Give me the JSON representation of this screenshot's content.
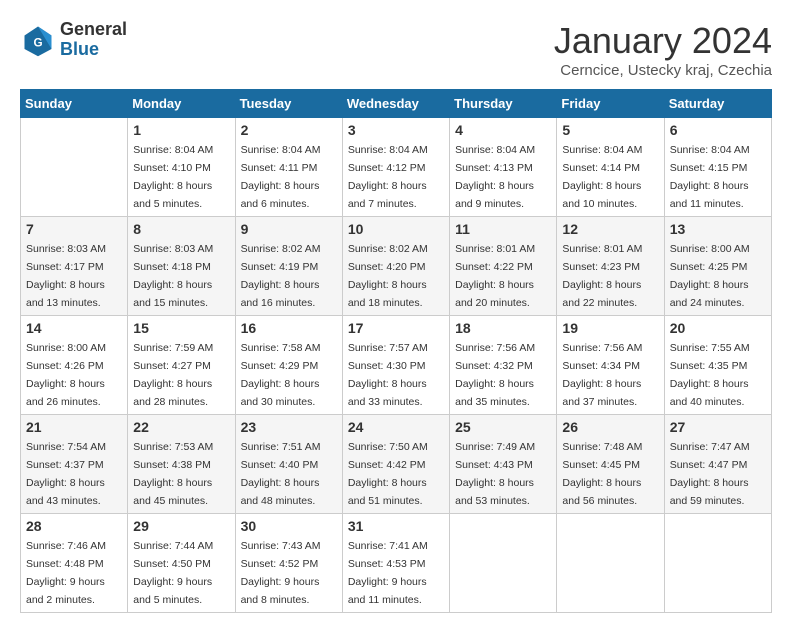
{
  "header": {
    "logo_general": "General",
    "logo_blue": "Blue",
    "month_title": "January 2024",
    "subtitle": "Cerncice, Ustecky kraj, Czechia"
  },
  "weekdays": [
    "Sunday",
    "Monday",
    "Tuesday",
    "Wednesday",
    "Thursday",
    "Friday",
    "Saturday"
  ],
  "weeks": [
    [
      {
        "day": "",
        "sunrise": "",
        "sunset": "",
        "daylight": ""
      },
      {
        "day": "1",
        "sunrise": "Sunrise: 8:04 AM",
        "sunset": "Sunset: 4:10 PM",
        "daylight": "Daylight: 8 hours and 5 minutes."
      },
      {
        "day": "2",
        "sunrise": "Sunrise: 8:04 AM",
        "sunset": "Sunset: 4:11 PM",
        "daylight": "Daylight: 8 hours and 6 minutes."
      },
      {
        "day": "3",
        "sunrise": "Sunrise: 8:04 AM",
        "sunset": "Sunset: 4:12 PM",
        "daylight": "Daylight: 8 hours and 7 minutes."
      },
      {
        "day": "4",
        "sunrise": "Sunrise: 8:04 AM",
        "sunset": "Sunset: 4:13 PM",
        "daylight": "Daylight: 8 hours and 9 minutes."
      },
      {
        "day": "5",
        "sunrise": "Sunrise: 8:04 AM",
        "sunset": "Sunset: 4:14 PM",
        "daylight": "Daylight: 8 hours and 10 minutes."
      },
      {
        "day": "6",
        "sunrise": "Sunrise: 8:04 AM",
        "sunset": "Sunset: 4:15 PM",
        "daylight": "Daylight: 8 hours and 11 minutes."
      }
    ],
    [
      {
        "day": "7",
        "sunrise": "Sunrise: 8:03 AM",
        "sunset": "Sunset: 4:17 PM",
        "daylight": "Daylight: 8 hours and 13 minutes."
      },
      {
        "day": "8",
        "sunrise": "Sunrise: 8:03 AM",
        "sunset": "Sunset: 4:18 PM",
        "daylight": "Daylight: 8 hours and 15 minutes."
      },
      {
        "day": "9",
        "sunrise": "Sunrise: 8:02 AM",
        "sunset": "Sunset: 4:19 PM",
        "daylight": "Daylight: 8 hours and 16 minutes."
      },
      {
        "day": "10",
        "sunrise": "Sunrise: 8:02 AM",
        "sunset": "Sunset: 4:20 PM",
        "daylight": "Daylight: 8 hours and 18 minutes."
      },
      {
        "day": "11",
        "sunrise": "Sunrise: 8:01 AM",
        "sunset": "Sunset: 4:22 PM",
        "daylight": "Daylight: 8 hours and 20 minutes."
      },
      {
        "day": "12",
        "sunrise": "Sunrise: 8:01 AM",
        "sunset": "Sunset: 4:23 PM",
        "daylight": "Daylight: 8 hours and 22 minutes."
      },
      {
        "day": "13",
        "sunrise": "Sunrise: 8:00 AM",
        "sunset": "Sunset: 4:25 PM",
        "daylight": "Daylight: 8 hours and 24 minutes."
      }
    ],
    [
      {
        "day": "14",
        "sunrise": "Sunrise: 8:00 AM",
        "sunset": "Sunset: 4:26 PM",
        "daylight": "Daylight: 8 hours and 26 minutes."
      },
      {
        "day": "15",
        "sunrise": "Sunrise: 7:59 AM",
        "sunset": "Sunset: 4:27 PM",
        "daylight": "Daylight: 8 hours and 28 minutes."
      },
      {
        "day": "16",
        "sunrise": "Sunrise: 7:58 AM",
        "sunset": "Sunset: 4:29 PM",
        "daylight": "Daylight: 8 hours and 30 minutes."
      },
      {
        "day": "17",
        "sunrise": "Sunrise: 7:57 AM",
        "sunset": "Sunset: 4:30 PM",
        "daylight": "Daylight: 8 hours and 33 minutes."
      },
      {
        "day": "18",
        "sunrise": "Sunrise: 7:56 AM",
        "sunset": "Sunset: 4:32 PM",
        "daylight": "Daylight: 8 hours and 35 minutes."
      },
      {
        "day": "19",
        "sunrise": "Sunrise: 7:56 AM",
        "sunset": "Sunset: 4:34 PM",
        "daylight": "Daylight: 8 hours and 37 minutes."
      },
      {
        "day": "20",
        "sunrise": "Sunrise: 7:55 AM",
        "sunset": "Sunset: 4:35 PM",
        "daylight": "Daylight: 8 hours and 40 minutes."
      }
    ],
    [
      {
        "day": "21",
        "sunrise": "Sunrise: 7:54 AM",
        "sunset": "Sunset: 4:37 PM",
        "daylight": "Daylight: 8 hours and 43 minutes."
      },
      {
        "day": "22",
        "sunrise": "Sunrise: 7:53 AM",
        "sunset": "Sunset: 4:38 PM",
        "daylight": "Daylight: 8 hours and 45 minutes."
      },
      {
        "day": "23",
        "sunrise": "Sunrise: 7:51 AM",
        "sunset": "Sunset: 4:40 PM",
        "daylight": "Daylight: 8 hours and 48 minutes."
      },
      {
        "day": "24",
        "sunrise": "Sunrise: 7:50 AM",
        "sunset": "Sunset: 4:42 PM",
        "daylight": "Daylight: 8 hours and 51 minutes."
      },
      {
        "day": "25",
        "sunrise": "Sunrise: 7:49 AM",
        "sunset": "Sunset: 4:43 PM",
        "daylight": "Daylight: 8 hours and 53 minutes."
      },
      {
        "day": "26",
        "sunrise": "Sunrise: 7:48 AM",
        "sunset": "Sunset: 4:45 PM",
        "daylight": "Daylight: 8 hours and 56 minutes."
      },
      {
        "day": "27",
        "sunrise": "Sunrise: 7:47 AM",
        "sunset": "Sunset: 4:47 PM",
        "daylight": "Daylight: 8 hours and 59 minutes."
      }
    ],
    [
      {
        "day": "28",
        "sunrise": "Sunrise: 7:46 AM",
        "sunset": "Sunset: 4:48 PM",
        "daylight": "Daylight: 9 hours and 2 minutes."
      },
      {
        "day": "29",
        "sunrise": "Sunrise: 7:44 AM",
        "sunset": "Sunset: 4:50 PM",
        "daylight": "Daylight: 9 hours and 5 minutes."
      },
      {
        "day": "30",
        "sunrise": "Sunrise: 7:43 AM",
        "sunset": "Sunset: 4:52 PM",
        "daylight": "Daylight: 9 hours and 8 minutes."
      },
      {
        "day": "31",
        "sunrise": "Sunrise: 7:41 AM",
        "sunset": "Sunset: 4:53 PM",
        "daylight": "Daylight: 9 hours and 11 minutes."
      },
      {
        "day": "",
        "sunrise": "",
        "sunset": "",
        "daylight": ""
      },
      {
        "day": "",
        "sunrise": "",
        "sunset": "",
        "daylight": ""
      },
      {
        "day": "",
        "sunrise": "",
        "sunset": "",
        "daylight": ""
      }
    ]
  ]
}
